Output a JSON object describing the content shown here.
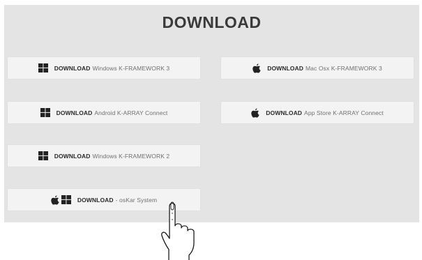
{
  "page": {
    "title": "DOWNLOAD"
  },
  "buttons": [
    {
      "strong": "DOWNLOAD",
      "text": "Windows K-FRAMEWORK 3",
      "icons": [
        "windows-icon"
      ]
    },
    {
      "strong": "DOWNLOAD",
      "text": "Mac Osx K-FRAMEWORK 3",
      "icons": [
        "apple-icon"
      ]
    },
    {
      "strong": "DOWNLOAD",
      "text": "Android K-ARRAY Connect",
      "icons": [
        "windows-icon"
      ]
    },
    {
      "strong": "DOWNLOAD",
      "text": "App Store K-ARRAY Connect",
      "icons": [
        "apple-icon"
      ]
    },
    {
      "strong": "DOWNLOAD",
      "text": "Windows K-FRAMEWORK 2",
      "icons": [
        "windows-icon"
      ]
    },
    {
      "strong": "DOWNLOAD",
      "text": "- osKar System",
      "icons": [
        "apple-icon",
        "windows-icon"
      ]
    }
  ],
  "cursor": {
    "icon": "pointer-hand-icon"
  },
  "colors": {
    "panel": "#e4e4e4",
    "button": "#f3f3f3",
    "title": "#3a3a3a",
    "strong_text": "#2a2a2a",
    "plain_text": "#707070"
  }
}
